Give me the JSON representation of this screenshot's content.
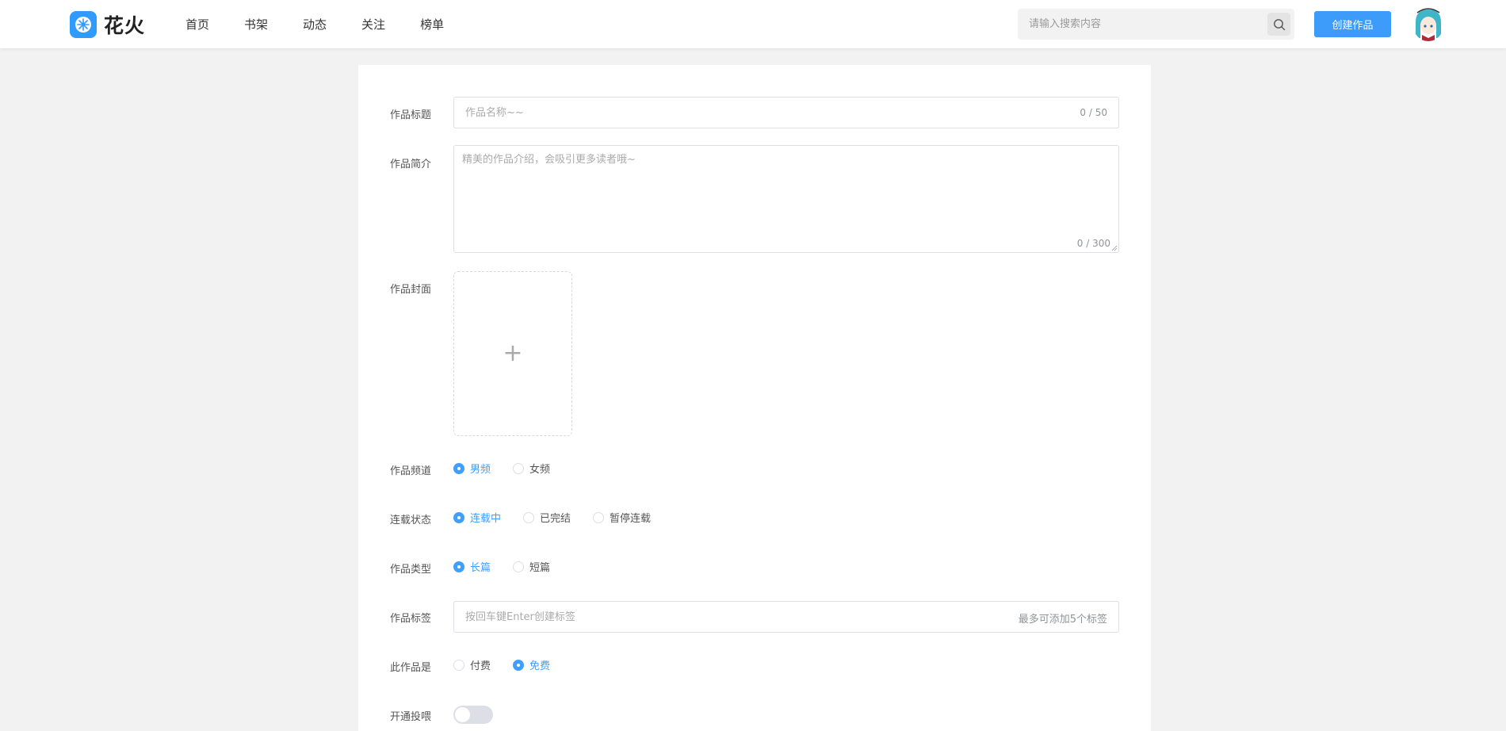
{
  "brand": {
    "name": "花火",
    "color": "#2f9bff"
  },
  "nav": {
    "items": [
      {
        "label": "首页"
      },
      {
        "label": "书架"
      },
      {
        "label": "动态"
      },
      {
        "label": "关注"
      },
      {
        "label": "榜单"
      }
    ]
  },
  "search": {
    "placeholder": "请输入搜索内容",
    "icon": "search-icon"
  },
  "actions": {
    "create_label": "创建作品",
    "accent": "#3d9bfa"
  },
  "form": {
    "title": {
      "label": "作品标题",
      "placeholder": "作品名称~~",
      "count": "0 / 50"
    },
    "intro": {
      "label": "作品简介",
      "placeholder": "精美的作品介绍，会吸引更多读者哦~",
      "count": "0 / 300"
    },
    "cover": {
      "label": "作品封面",
      "icon": "plus-icon",
      "symbol": "+"
    },
    "channel": {
      "label": "作品频道",
      "options": [
        "男频",
        "女频"
      ],
      "selected": "男频"
    },
    "status": {
      "label": "连载状态",
      "options": [
        "连载中",
        "已完结",
        "暂停连载"
      ],
      "selected": "连载中"
    },
    "type": {
      "label": "作品类型",
      "options": [
        "长篇",
        "短篇"
      ],
      "selected": "长篇"
    },
    "tags": {
      "label": "作品标签",
      "placeholder": "按回车键Enter创建标签",
      "hint": "最多可添加5个标签"
    },
    "pricing": {
      "label": "此作品是",
      "options": [
        "付费",
        "免费"
      ],
      "selected": "免费"
    },
    "feeding": {
      "label": "开通投喂",
      "enabled": false
    }
  }
}
